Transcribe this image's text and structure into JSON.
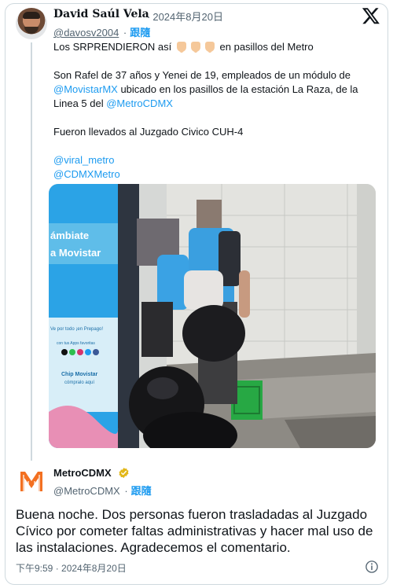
{
  "quoted": {
    "display_name": "David Saúl Vela",
    "date": "2024年8月20日",
    "handle": "@davosv2004",
    "follow_label": "跟隨",
    "text": {
      "line1_prefix": "Los SRPRENDIERON así",
      "line1_suffix": "en pasillos del Metro",
      "p2_a": "Son Rafel de 37 años y Yenei de 19, empleados de un módulo de",
      "p2_mention1": "@MovistarMX",
      "p2_b": " ubicado en los pasillos de la estación La Raza, de la Linea 5 del ",
      "p2_mention2": "@MetroCDMX",
      "p3": "Fueron llevados al Juzgado Civico CUH-4",
      "mention3": "@viral_metro",
      "mention4": "@CDMXMetro"
    },
    "photo_signage": {
      "line1": "ámbiate",
      "line2": "a Movistar",
      "line3": "Ve por todo ¡en Prepago!",
      "line4": "con tus Apps favoritas",
      "line5": "Chip Movistar",
      "line6": "cómpralo aquí"
    }
  },
  "reply": {
    "display_name": "MetroCDMX",
    "handle": "@MetroCDMX",
    "follow_label": "跟隨",
    "text": "Buena noche. Dos personas fueron trasladadas al Juzgado Cívico por cometer faltas administrativas y hacer mal uso de las instalaciones. Agradecemos el comentario.",
    "timestamp": "下午9:59 · 2024年8月20日"
  },
  "colors": {
    "link": "#1d9bf0",
    "verified_badge": "#e2b719",
    "metro_orange": "#f37021",
    "text_secondary": "#536471"
  },
  "icons": [
    "x-logo-icon",
    "verified-badge-icon",
    "info-icon",
    "metro-logo-icon"
  ]
}
